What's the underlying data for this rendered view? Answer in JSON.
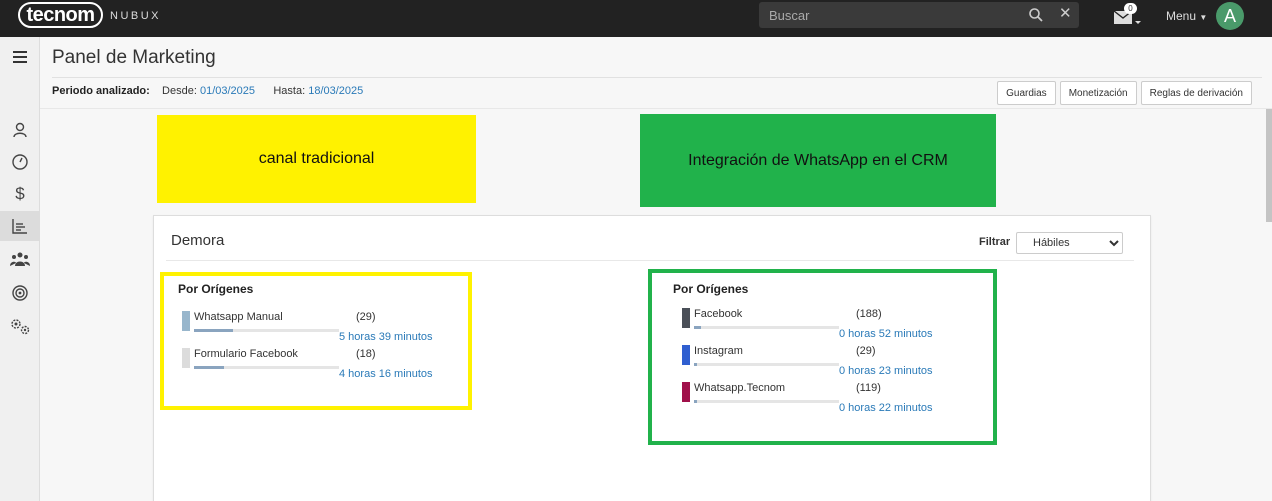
{
  "topbar": {
    "logo": "tecnom",
    "logo_sub": "NUBUX",
    "search_placeholder": "Buscar",
    "mail_badge": "0",
    "menu_label": "Menu",
    "avatar_letter": "A"
  },
  "header": {
    "title": "Panel de Marketing",
    "periodo_label": "Periodo analizado:",
    "desde_label": "Desde:",
    "desde_value": "01/03/2025",
    "hasta_label": "Hasta:",
    "hasta_value": "18/03/2025",
    "buttons": [
      "Guardias",
      "Monetización",
      "Reglas de derivación"
    ]
  },
  "notes": {
    "yellow": "canal tradicional",
    "green": "Integración de WhatsApp en el CRM"
  },
  "panel": {
    "title": "Demora",
    "filter_label": "Filtrar",
    "filter_value": "Hábiles",
    "left": {
      "title": "Por Orígenes",
      "items": [
        {
          "name": "Whatsapp Manual",
          "count": "(29)",
          "time": "5 horas 39 minutos",
          "color": "#98b6cc",
          "progress": 0.27
        },
        {
          "name": "Formulario Facebook",
          "count": "(18)",
          "time": "4 horas 16 minutos",
          "color": "#dcdcdc",
          "progress": 0.21
        }
      ]
    },
    "right": {
      "title": "Por Orígenes",
      "items": [
        {
          "name": "Facebook",
          "count": "(188)",
          "time": "0 horas 52 minutos",
          "color": "#4a4f58",
          "progress": 0.05
        },
        {
          "name": "Instagram",
          "count": "(29)",
          "time": "0 horas 23 minutos",
          "color": "#2f5fd0",
          "progress": 0.02
        },
        {
          "name": "Whatsapp.Tecnom",
          "count": "(119)",
          "time": "0 horas 22 minutos",
          "color": "#a0104a",
          "progress": 0.02
        }
      ]
    }
  },
  "colors": {
    "note_yellow": "#fff200",
    "note_green": "#21b24b",
    "link": "#2a7ab8"
  }
}
